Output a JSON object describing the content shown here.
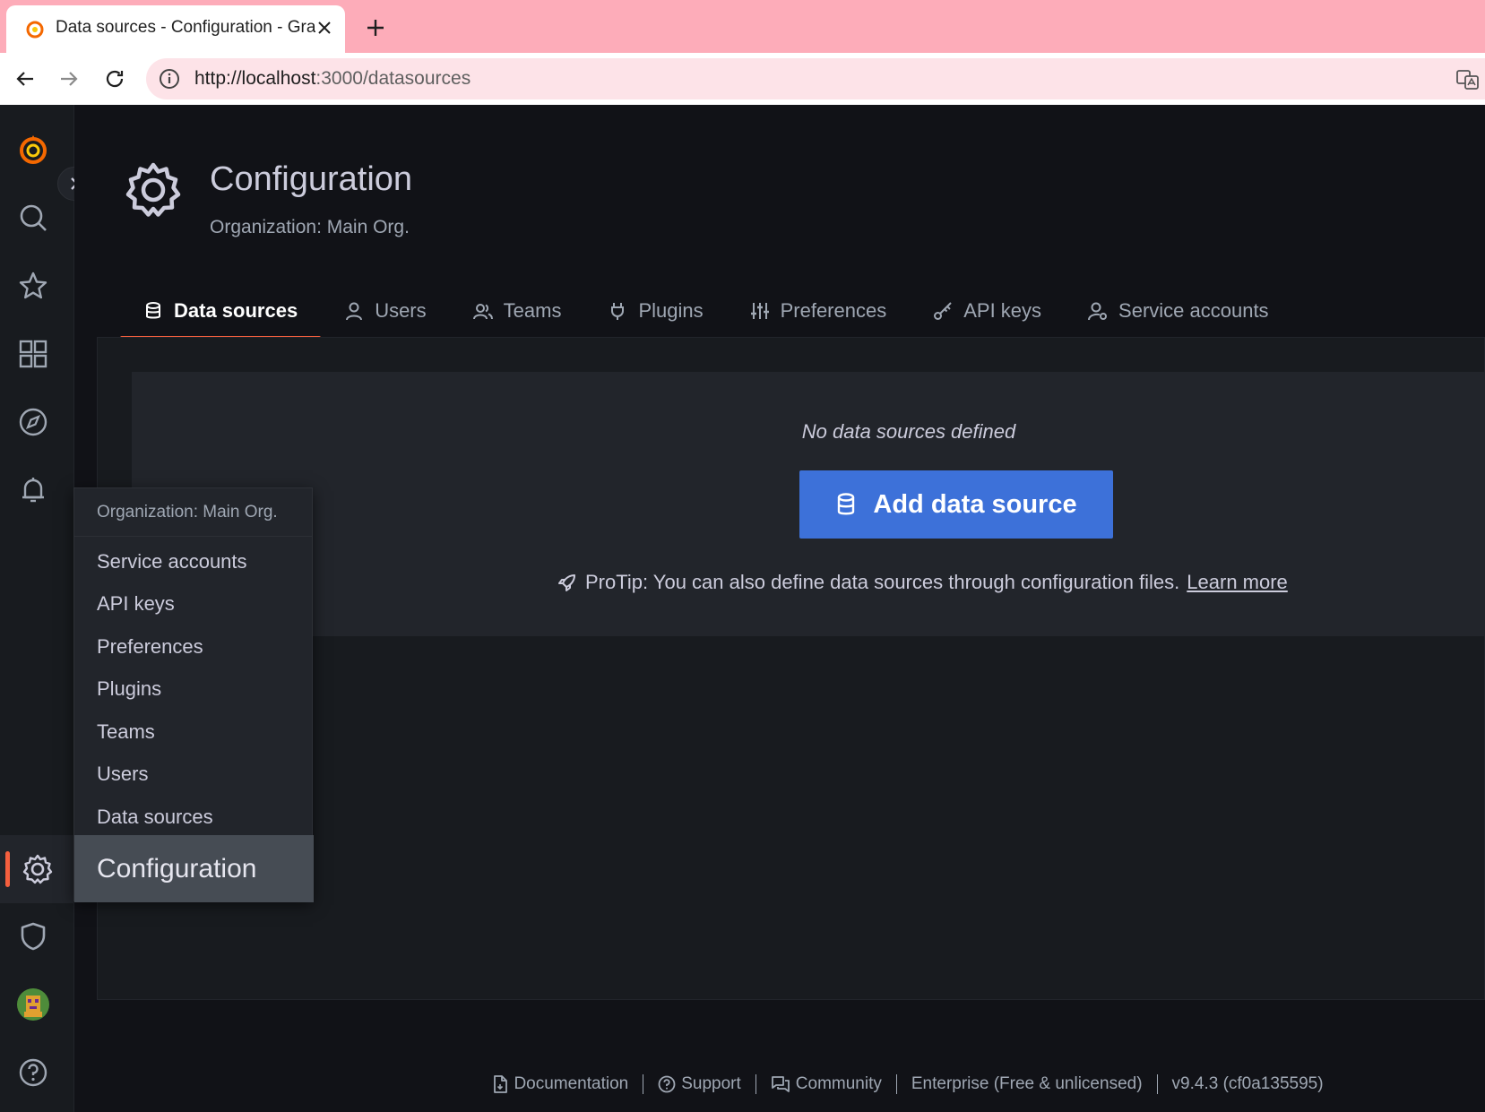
{
  "browser": {
    "tab_title": "Data sources - Configuration - Grafana",
    "url_host": "http://localhost",
    "url_path": ":3000/datasources"
  },
  "sidenav": {
    "items": [
      "grafana-logo-icon",
      "search-icon",
      "star-icon",
      "dashboards-icon",
      "explore-icon",
      "alerting-icon",
      "gear-icon",
      "shield-icon",
      "avatar",
      "help-icon"
    ],
    "active": "configuration"
  },
  "page": {
    "title": "Configuration",
    "subtitle": "Organization: Main Org."
  },
  "tabs": [
    {
      "label": "Data sources",
      "icon": "database-icon",
      "active": true
    },
    {
      "label": "Users",
      "icon": "user-icon",
      "active": false
    },
    {
      "label": "Teams",
      "icon": "users-icon",
      "active": false
    },
    {
      "label": "Plugins",
      "icon": "plug-icon",
      "active": false
    },
    {
      "label": "Preferences",
      "icon": "sliders-icon",
      "active": false
    },
    {
      "label": "API keys",
      "icon": "key-icon",
      "active": false
    },
    {
      "label": "Service accounts",
      "icon": "user-cog-icon",
      "active": false
    }
  ],
  "empty_state": {
    "title": "No data sources defined",
    "button_label": "Add data source",
    "protip": "ProTip: You can also define data sources through configuration files.",
    "learn_more": "Learn more"
  },
  "flyout": {
    "header": "Organization: Main Org.",
    "items": [
      "Service accounts",
      "API keys",
      "Preferences",
      "Plugins",
      "Teams",
      "Users",
      "Data sources"
    ],
    "title": "Configuration"
  },
  "footer": {
    "documentation": "Documentation",
    "support": "Support",
    "community": "Community",
    "edition": "Enterprise (Free & unlicensed)",
    "version": "v9.4.3 (cf0a135595)"
  },
  "colors": {
    "accent": "#f55f3e",
    "primary_button": "#3d71d9",
    "background": "#111217",
    "panel": "#181b1f"
  }
}
